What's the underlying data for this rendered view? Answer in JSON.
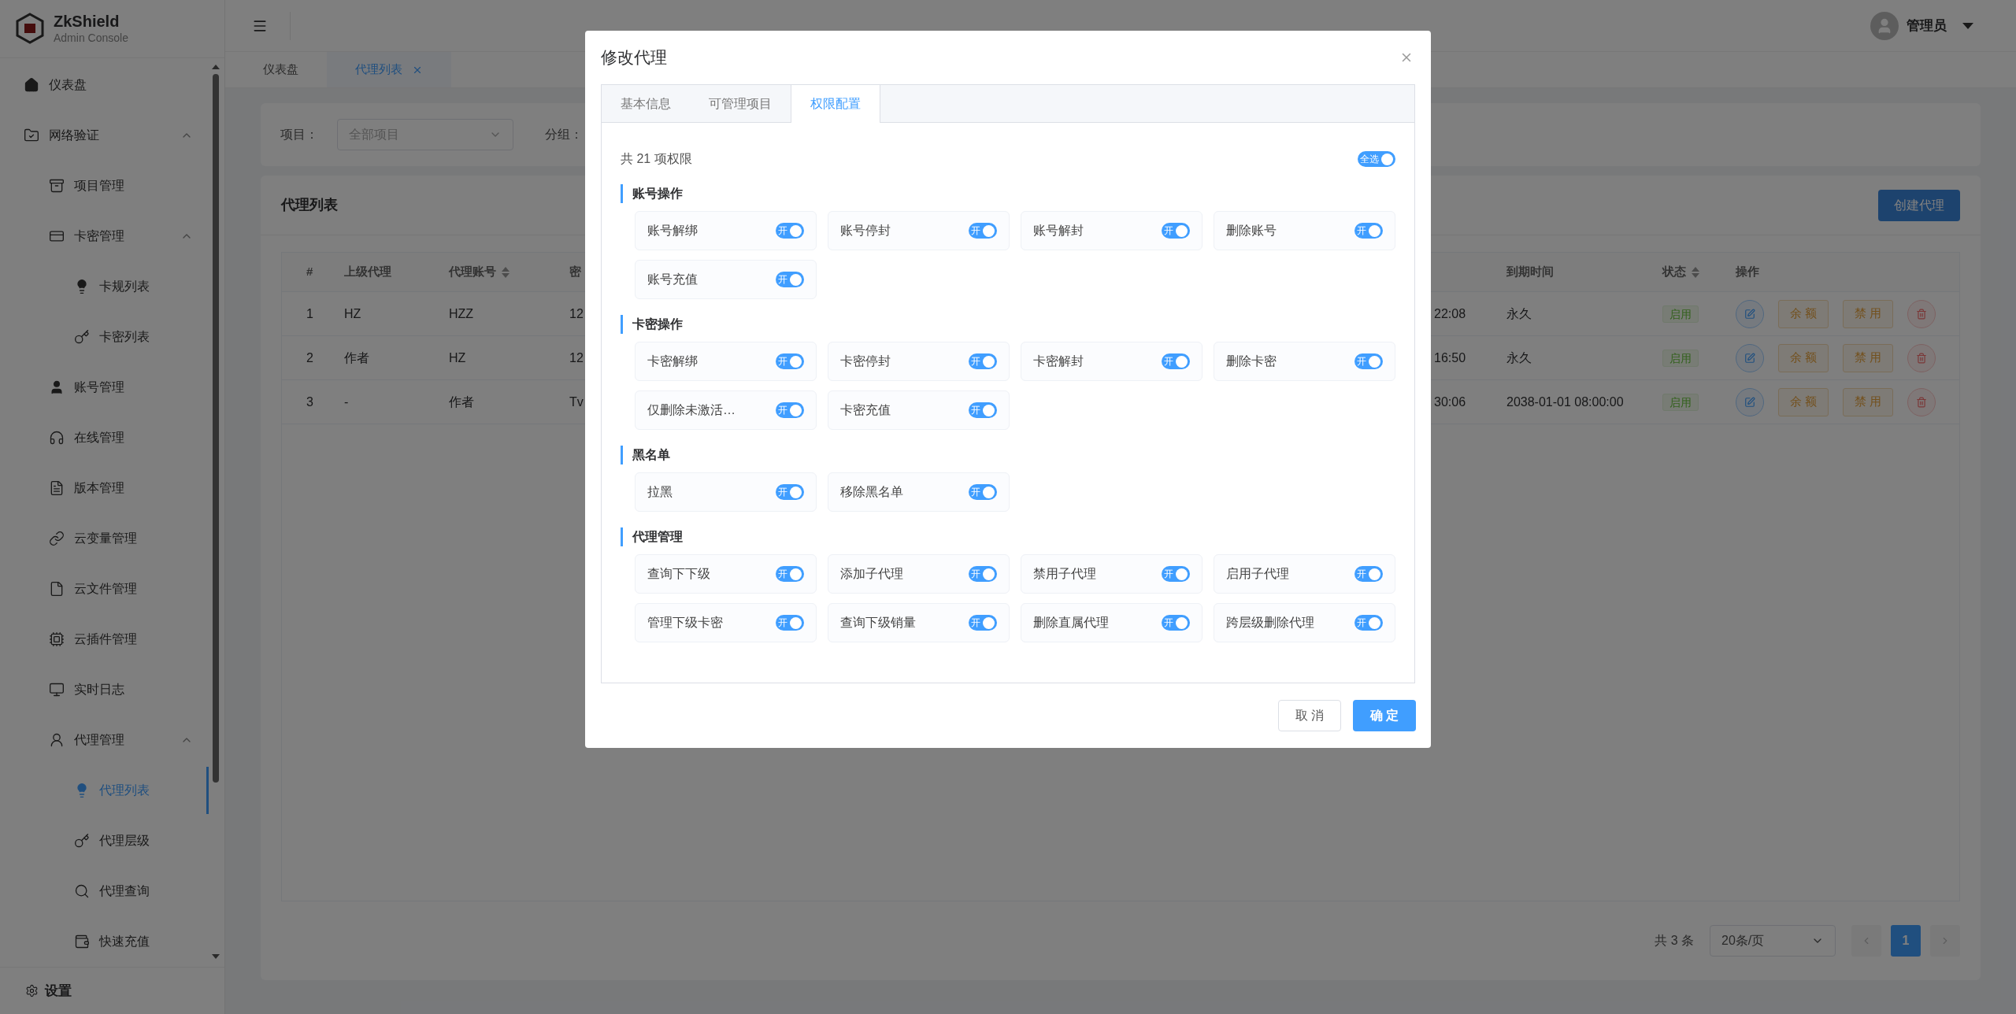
{
  "sidebar": {
    "logo": {
      "title": "ZkShield",
      "subtitle": "Admin Console"
    },
    "menu": [
      {
        "label": "仪表盘",
        "selected": false
      },
      {
        "label": "网络验证",
        "selected": false,
        "expanded": true,
        "children": [
          {
            "label": "项目管理",
            "selected": false
          },
          {
            "label": "卡密管理",
            "selected": false,
            "expanded": true,
            "children": [
              {
                "label": "卡规列表",
                "selected": false
              },
              {
                "label": "卡密列表",
                "selected": false
              }
            ]
          },
          {
            "label": "账号管理",
            "selected": false
          },
          {
            "label": "在线管理",
            "selected": false
          },
          {
            "label": "版本管理",
            "selected": false
          },
          {
            "label": "云变量管理",
            "selected": false
          },
          {
            "label": "云文件管理",
            "selected": false
          },
          {
            "label": "云插件管理",
            "selected": false
          },
          {
            "label": "实时日志",
            "selected": false
          },
          {
            "label": "代理管理",
            "selected": false,
            "expanded": true,
            "children": [
              {
                "label": "代理列表",
                "selected": true
              },
              {
                "label": "代理层级",
                "selected": false
              },
              {
                "label": "代理查询",
                "selected": false
              },
              {
                "label": "快速充值",
                "selected": false
              }
            ]
          }
        ]
      }
    ],
    "settings": "设置"
  },
  "header": {
    "user": "管理员"
  },
  "page_tabs": [
    {
      "label": "仪表盘",
      "selected": false,
      "closable": false
    },
    {
      "label": "代理列表",
      "selected": true,
      "closable": true
    }
  ],
  "filters": [
    {
      "label": "项目：",
      "placeholder": "全部项目"
    },
    {
      "label": "分组："
    }
  ],
  "table": {
    "title": "代理列表",
    "create_button": "创建代理",
    "columns": [
      {
        "label": "#",
        "sortable": false
      },
      {
        "label": "上级代理",
        "sortable": false
      },
      {
        "label": "代理账号",
        "sortable": true
      },
      {
        "label": "密",
        "sortable": false
      },
      {
        "sortable": false
      },
      {
        "label": "到期时间",
        "sortable": false
      },
      {
        "label": "状态",
        "sortable": true
      },
      {
        "label": "操作",
        "sortable": false
      }
    ],
    "rows": [
      {
        "cells": [
          "1",
          "HZ",
          "HZZ",
          "12",
          "22:08",
          "永久"
        ],
        "status": "启用",
        "actions": [
          "余 额",
          "禁 用"
        ]
      },
      {
        "cells": [
          "2",
          "作者",
          "HZ",
          "12",
          "16:50",
          "永久"
        ],
        "status": "启用",
        "actions": [
          "余 额",
          "禁 用"
        ]
      },
      {
        "cells": [
          "3",
          "-",
          "作者",
          "Tv",
          "30:06",
          "2038-01-01 08:00:00"
        ],
        "status": "启用",
        "actions": [
          "余 额",
          "禁 用"
        ]
      }
    ],
    "pagination": {
      "total": "共 3 条",
      "page_size": "20条/页",
      "pages": [
        {
          "label": "1",
          "selected": true
        }
      ]
    }
  },
  "dialog": {
    "title": "修改代理",
    "tabs": [
      {
        "label": "基本信息",
        "selected": false
      },
      {
        "label": "可管理项目",
        "selected": false
      },
      {
        "label": "权限配置",
        "selected": true
      }
    ],
    "summary": "共 21 项权限",
    "select_all": {
      "label": "全选",
      "on": true
    },
    "groups": [
      {
        "title": "账号操作",
        "permissions": [
          {
            "label": "账号解绑",
            "on": true,
            "switch_text": "开"
          },
          {
            "label": "账号停封",
            "on": true,
            "switch_text": "开"
          },
          {
            "label": "账号解封",
            "on": true,
            "switch_text": "开"
          },
          {
            "label": "删除账号",
            "on": true,
            "switch_text": "开"
          },
          {
            "label": "账号充值",
            "on": true,
            "switch_text": "开"
          }
        ]
      },
      {
        "title": "卡密操作",
        "permissions": [
          {
            "label": "卡密解绑",
            "on": true,
            "switch_text": "开"
          },
          {
            "label": "卡密停封",
            "on": true,
            "switch_text": "开"
          },
          {
            "label": "卡密解封",
            "on": true,
            "switch_text": "开"
          },
          {
            "label": "删除卡密",
            "on": true,
            "switch_text": "开"
          },
          {
            "label": "仅删除未激活…",
            "on": true,
            "switch_text": "开"
          },
          {
            "label": "卡密充值",
            "on": true,
            "switch_text": "开"
          }
        ]
      },
      {
        "title": "黑名单",
        "permissions": [
          {
            "label": "拉黑",
            "on": true,
            "switch_text": "开"
          },
          {
            "label": "移除黑名单",
            "on": true,
            "switch_text": "开"
          }
        ]
      },
      {
        "title": "代理管理",
        "permissions": [
          {
            "label": "查询下下级",
            "on": true,
            "switch_text": "开"
          },
          {
            "label": "添加子代理",
            "on": true,
            "switch_text": "开"
          },
          {
            "label": "禁用子代理",
            "on": true,
            "switch_text": "开"
          },
          {
            "label": "启用子代理",
            "on": true,
            "switch_text": "开"
          },
          {
            "label": "管理下级卡密",
            "on": true,
            "switch_text": "开"
          },
          {
            "label": "查询下级销量",
            "on": true,
            "switch_text": "开"
          },
          {
            "label": "删除直属代理",
            "on": true,
            "switch_text": "开"
          },
          {
            "label": "跨层级删除代理",
            "on": true,
            "switch_text": "开"
          }
        ]
      }
    ],
    "buttons": {
      "cancel": "取 消",
      "confirm": "确 定"
    }
  }
}
